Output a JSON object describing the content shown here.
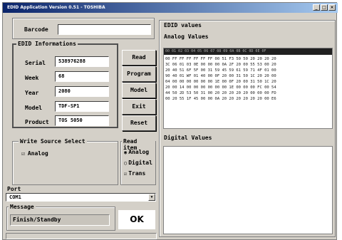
{
  "window": {
    "title": "EDID Application Version 0.51 - TOSHIBA",
    "minimize": "_",
    "maximize": "□",
    "close": "×"
  },
  "barcode": {
    "label": "Barcode",
    "value": ""
  },
  "edid_info": {
    "title": "EDID Informations",
    "fields": [
      {
        "label": "Serial",
        "value": "538976288"
      },
      {
        "label": "Week",
        "value": "68"
      },
      {
        "label": "Year",
        "value": "2080"
      },
      {
        "label": "Model",
        "value": "TDF-SP1"
      },
      {
        "label": "Product",
        "value": "TOS 5050"
      }
    ]
  },
  "buttons": {
    "read": "Read",
    "program": "Program",
    "model": "Model",
    "exit": "Exit",
    "reset": "Reset",
    "ok": "OK"
  },
  "write_source": {
    "title": "Write Source Select",
    "analog_label": "Analog",
    "analog_checked": true
  },
  "read_item": {
    "title": "Read item",
    "analog_label": "Analog",
    "analog_selected": true,
    "digital_label": "Digital",
    "digital_selected": false,
    "trans_label": "Trans",
    "trans_checked": true
  },
  "port": {
    "label": "Port",
    "value": "COM1"
  },
  "message": {
    "title": "Message",
    "value": "Finish/Standby"
  },
  "edid_values": {
    "title": "EDID values",
    "analog_title": "Analog Values",
    "hex_header": "00 01 02 03 04 05 06 07 08 09 0A 0B 0C 0D 0E 0F",
    "hex_lines": [
      "00 FF FF FF FF FF FF 00 51 F3 50 50 20 20 20 20",
      "3C 06 01 03 0E 00 00 00 0A 2F 20 00 55 53 00 20",
      "20 40 51 6F 5F 00 31 59 45 59 61 59 71 4F 01 00",
      "90 40 01 WF 01 40 00 0F 20 00 31 50 1C 20 20 00",
      "04 00 00 00 00 00 00 1E 00 0F 20 00 31 50 1C 20",
      "20 00 14 00 00 00 00 00 00 1E 00 00 00 FC 00 54",
      "44 50 2D 53 50 31 00 20 20 20 20 20 00 00 00 FD",
      "00 20 55 1F 45 00 00 0A 20 20 20 20 20 20 00 E6"
    ],
    "digital_title": "Digital Values"
  }
}
